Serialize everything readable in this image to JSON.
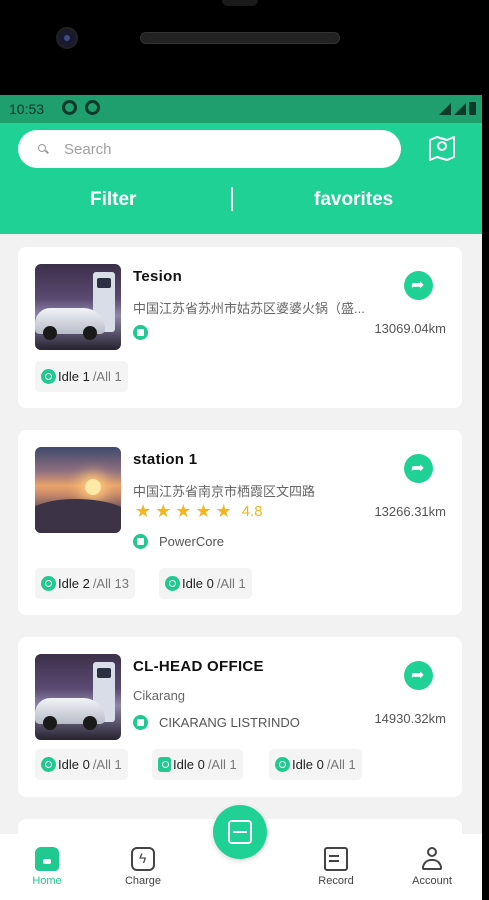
{
  "status_bar": {
    "time": "10:53"
  },
  "search": {
    "placeholder": "Search"
  },
  "tabs": {
    "filter": "Filter",
    "favorites": "favorites"
  },
  "stations": [
    {
      "name": "Tesion",
      "address": "中国江苏省苏州市姑苏区婆婆火锅（盛...",
      "distance": "13069.04km",
      "operator": "",
      "connectors": [
        {
          "idle": "Idle 1",
          "all": "/All 1"
        }
      ]
    },
    {
      "name": "station 1",
      "address": "中国江苏省南京市栖霞区文四路",
      "rating": "4.8",
      "stars": 5,
      "distance": "13266.31km",
      "operator": "PowerCore",
      "connectors": [
        {
          "idle": "Idle 2",
          "all": "/All 13"
        },
        {
          "idle": "Idle 0",
          "all": "/All 1"
        }
      ]
    },
    {
      "name": "CL-HEAD OFFICE",
      "address": "Cikarang",
      "distance": "14930.32km",
      "operator": "CIKARANG LISTRINDO",
      "connectors": [
        {
          "idle": "Idle 0",
          "all": "/All 1"
        },
        {
          "idle": "Idle 0",
          "all": "/All 1"
        },
        {
          "idle": "Idle 0",
          "all": "/All 1"
        }
      ]
    }
  ],
  "bottom_nav": {
    "home": "Home",
    "charge": "Charge",
    "record": "Record",
    "account": "Account"
  },
  "colors": {
    "accent": "#20d196",
    "status_bar": "#1f9e6e",
    "rating": "#f5b51c"
  },
  "icons": [
    "map-icon",
    "search-icon",
    "navigate-icon",
    "scan-icon",
    "home-icon",
    "charge-icon",
    "record-icon",
    "account-icon",
    "star-icon",
    "plug-icon"
  ]
}
